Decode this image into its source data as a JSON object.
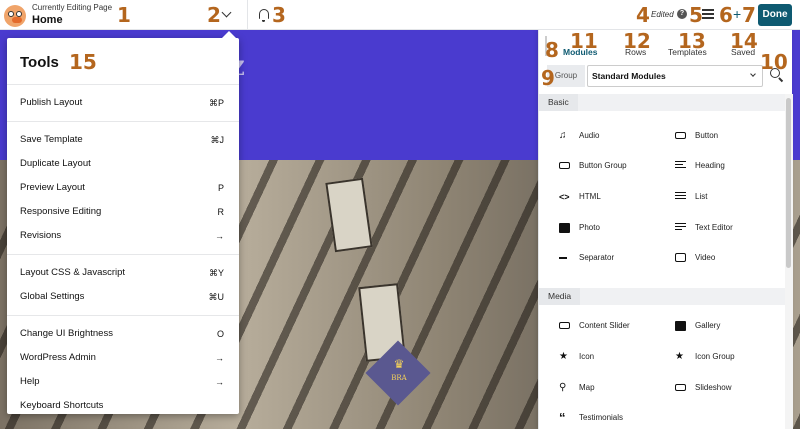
{
  "header": {
    "editing_sub": "Currently Editing Page",
    "page_title": "Home",
    "edited_label": "Edited",
    "help_glyph": "?",
    "done_label": "Done",
    "plus_glyph": "+",
    "icons": {
      "logo": "beaver-logo",
      "chevron": "chevron-down-icon",
      "notifications": "bell-icon",
      "outline": "list-icon",
      "add": "plus-icon"
    }
  },
  "callouts": [
    "1",
    "2",
    "3",
    "4",
    "5",
    "6",
    "7",
    "8",
    "9",
    "10",
    "11",
    "12",
    "13",
    "14",
    "15"
  ],
  "tools": {
    "title": "Tools",
    "groups": [
      [
        {
          "label": "Publish Layout",
          "shortcut": "⌘P"
        }
      ],
      [
        {
          "label": "Save Template",
          "shortcut": "⌘J"
        },
        {
          "label": "Duplicate Layout",
          "shortcut": ""
        },
        {
          "label": "Preview Layout",
          "shortcut": "P"
        },
        {
          "label": "Responsive Editing",
          "shortcut": "R"
        },
        {
          "label": "Revisions",
          "shortcut": "→"
        }
      ],
      [
        {
          "label": "Layout CSS & Javascript",
          "shortcut": "⌘Y"
        },
        {
          "label": "Global Settings",
          "shortcut": "⌘U"
        }
      ],
      [
        {
          "label": "Change UI Brightness",
          "shortcut": "O"
        },
        {
          "label": "WordPress Admin",
          "shortcut": "→"
        },
        {
          "label": "Help",
          "shortcut": "→"
        },
        {
          "label": "Keyboard Shortcuts",
          "shortcut": ""
        }
      ]
    ]
  },
  "canvas": {
    "hero_text": "Z",
    "crest_glyph": "♛",
    "crest_text": "BRA"
  },
  "panel": {
    "tabs": [
      "Modules",
      "Rows",
      "Templates",
      "Saved"
    ],
    "active_tab": "Modules",
    "group_label": "Group",
    "group_value": "Standard Modules",
    "sections": [
      {
        "title": "Basic",
        "modules": [
          {
            "label": "Audio",
            "icon": "music-note-icon"
          },
          {
            "label": "Button",
            "icon": "button-icon"
          },
          {
            "label": "Button Group",
            "icon": "button-group-icon"
          },
          {
            "label": "Heading",
            "icon": "heading-icon"
          },
          {
            "label": "HTML",
            "icon": "code-icon"
          },
          {
            "label": "List",
            "icon": "list-icon"
          },
          {
            "label": "Photo",
            "icon": "photo-icon"
          },
          {
            "label": "Text Editor",
            "icon": "text-editor-icon"
          },
          {
            "label": "Separator",
            "icon": "separator-icon"
          },
          {
            "label": "Video",
            "icon": "video-icon"
          }
        ]
      },
      {
        "title": "Media",
        "modules": [
          {
            "label": "Content Slider",
            "icon": "content-slider-icon"
          },
          {
            "label": "Gallery",
            "icon": "gallery-icon"
          },
          {
            "label": "Icon",
            "icon": "star-icon"
          },
          {
            "label": "Icon Group",
            "icon": "star-icon"
          },
          {
            "label": "Map",
            "icon": "map-pin-icon"
          },
          {
            "label": "Slideshow",
            "icon": "slideshow-icon"
          },
          {
            "label": "Testimonials",
            "icon": "quote-icon"
          }
        ]
      }
    ]
  },
  "colors": {
    "accent": "#0e5a71",
    "callout": "#b4661e",
    "hero": "#4a3bcf"
  }
}
